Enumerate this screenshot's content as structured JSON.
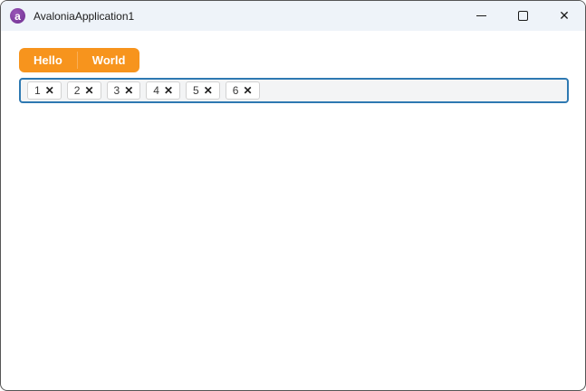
{
  "window": {
    "title": "AvaloniaApplication1",
    "icon_letter": "a",
    "close_glyph": "✕"
  },
  "segmented_button": {
    "items": [
      {
        "label": "Hello"
      },
      {
        "label": "World"
      }
    ]
  },
  "tag_input": {
    "chips": [
      "1",
      "2",
      "3",
      "4",
      "5",
      "6"
    ],
    "close_glyph": "✕"
  },
  "colors": {
    "accent_orange": "#F7941D",
    "tag_container_border": "#2E79B2",
    "titlebar_bg": "#EEF3F9",
    "logo_purple": "#7B3B9C"
  }
}
